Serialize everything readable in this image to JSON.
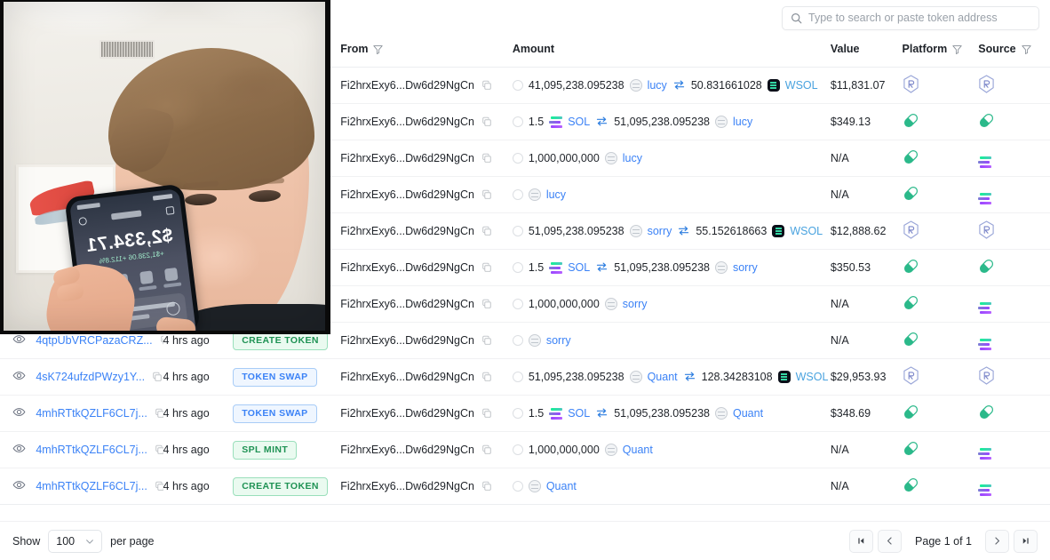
{
  "search": {
    "placeholder": "Type to search or paste token address",
    "value": "",
    "icon": "search-icon"
  },
  "table": {
    "headers": {
      "eye": "",
      "signature": "",
      "time": "",
      "type": "",
      "from": "From",
      "amount": "Amount",
      "value": "Value",
      "platform": "Platform",
      "source": "Source"
    },
    "rows": [
      {
        "signature": "",
        "time": "",
        "type": "",
        "from": "Fi2hrxExy6...Dw6d29NgCn",
        "amount": {
          "kind": "swap",
          "amount_in": "41,095,238.095238",
          "token_in": "lucy",
          "token_in_icon": "coin-icon",
          "amount_out": "50.831661028",
          "token_out": "WSOL",
          "token_out_icon": "wsol-icon"
        },
        "value": "$11,831.07",
        "platform": "raydium-icon",
        "source": "raydium-icon"
      },
      {
        "signature": "",
        "time": "",
        "type": "",
        "from": "Fi2hrxExy6...Dw6d29NgCn",
        "amount": {
          "kind": "swap",
          "amount_in": "1.5",
          "token_in": "SOL",
          "token_in_icon": "solana-icon",
          "amount_out": "51,095,238.095238",
          "token_out": "lucy",
          "token_out_icon": "coin-icon"
        },
        "value": "$349.13",
        "platform": "pumpfun-icon",
        "source": "pumpfun-icon"
      },
      {
        "signature": "",
        "time": "",
        "type": "",
        "from": "Fi2hrxExy6...Dw6d29NgCn",
        "amount": {
          "kind": "single",
          "amount_in": "1,000,000,000",
          "token_in": "lucy",
          "token_in_icon": "coin-icon"
        },
        "value": "N/A",
        "platform": "pumpfun-icon",
        "source": "solana-icon"
      },
      {
        "signature": "",
        "time": "",
        "type": "",
        "from": "Fi2hrxExy6...Dw6d29NgCn",
        "amount": {
          "kind": "token-only",
          "token_in": "lucy",
          "token_in_icon": "coin-icon"
        },
        "value": "N/A",
        "platform": "pumpfun-icon",
        "source": "solana-icon"
      },
      {
        "signature": "",
        "time": "",
        "type": "",
        "from": "Fi2hrxExy6...Dw6d29NgCn",
        "amount": {
          "kind": "swap",
          "amount_in": "51,095,238.095238",
          "token_in": "sorry",
          "token_in_icon": "coin-icon",
          "amount_out": "55.152618663",
          "token_out": "WSOL",
          "token_out_icon": "wsol-icon"
        },
        "value": "$12,888.62",
        "platform": "raydium-icon",
        "source": "raydium-icon"
      },
      {
        "signature": "",
        "time": "",
        "type": "",
        "from": "Fi2hrxExy6...Dw6d29NgCn",
        "amount": {
          "kind": "swap",
          "amount_in": "1.5",
          "token_in": "SOL",
          "token_in_icon": "solana-icon",
          "amount_out": "51,095,238.095238",
          "token_out": "sorry",
          "token_out_icon": "coin-icon"
        },
        "value": "$350.53",
        "platform": "pumpfun-icon",
        "source": "pumpfun-icon"
      },
      {
        "signature": "",
        "time": "",
        "type": "",
        "from": "Fi2hrxExy6...Dw6d29NgCn",
        "amount": {
          "kind": "single",
          "amount_in": "1,000,000,000",
          "token_in": "sorry",
          "token_in_icon": "coin-icon"
        },
        "value": "N/A",
        "platform": "pumpfun-icon",
        "source": "solana-icon"
      },
      {
        "signature": "4qtpUbVRCPazaCRZ...",
        "time": "4 hrs ago",
        "type": "CREATE TOKEN",
        "type_style": "create",
        "from": "Fi2hrxExy6...Dw6d29NgCn",
        "amount": {
          "kind": "token-only",
          "token_in": "sorry",
          "token_in_icon": "coin-icon"
        },
        "value": "N/A",
        "platform": "pumpfun-icon",
        "source": "solana-icon"
      },
      {
        "signature": "4sK724ufzdPWzy1Y...",
        "time": "4 hrs ago",
        "type": "TOKEN SWAP",
        "type_style": "swap",
        "from": "Fi2hrxExy6...Dw6d29NgCn",
        "amount": {
          "kind": "swap",
          "amount_in": "51,095,238.095238",
          "token_in": "Quant",
          "token_in_icon": "coin-icon",
          "amount_out": "128.34283108",
          "token_out": "WSOL",
          "token_out_icon": "wsol-icon"
        },
        "value": "$29,953.93",
        "platform": "raydium-icon",
        "source": "raydium-icon"
      },
      {
        "signature": "4mhRTtkQZLF6CL7j...",
        "time": "4 hrs ago",
        "type": "TOKEN SWAP",
        "type_style": "swap",
        "from": "Fi2hrxExy6...Dw6d29NgCn",
        "amount": {
          "kind": "swap",
          "amount_in": "1.5",
          "token_in": "SOL",
          "token_in_icon": "solana-icon",
          "amount_out": "51,095,238.095238",
          "token_out": "Quant",
          "token_out_icon": "coin-icon"
        },
        "value": "$348.69",
        "platform": "pumpfun-icon",
        "source": "pumpfun-icon"
      },
      {
        "signature": "4mhRTtkQZLF6CL7j...",
        "time": "4 hrs ago",
        "type": "SPL MINT",
        "type_style": "mint",
        "from": "Fi2hrxExy6...Dw6d29NgCn",
        "amount": {
          "kind": "single",
          "amount_in": "1,000,000,000",
          "token_in": "Quant",
          "token_in_icon": "coin-icon"
        },
        "value": "N/A",
        "platform": "pumpfun-icon",
        "source": "solana-icon"
      },
      {
        "signature": "4mhRTtkQZLF6CL7j...",
        "time": "4 hrs ago",
        "type": "CREATE TOKEN",
        "type_style": "create",
        "from": "Fi2hrxExy6...Dw6d29NgCn",
        "amount": {
          "kind": "token-only",
          "token_in": "Quant",
          "token_in_icon": "coin-icon"
        },
        "value": "N/A",
        "platform": "pumpfun-icon",
        "source": "solana-icon"
      }
    ]
  },
  "footer": {
    "show_label": "Show",
    "per_page_value": "100",
    "per_page_label": "per page",
    "page_label": "Page 1 of 1",
    "first_icon": "first-page-icon",
    "prev_icon": "previous-page-icon",
    "next_icon": "next-page-icon",
    "last_icon": "last-page-icon"
  },
  "video_overlay": {
    "phone_amount": "$2,334.71",
    "phone_subtitle": "+$1,238.06  +112.8%"
  },
  "colors": {
    "link": "#3b82f6",
    "green_badge_text": "#1f9254",
    "blue_badge_text": "#3b82f6",
    "swap_arrow": "#2f7fe0"
  }
}
